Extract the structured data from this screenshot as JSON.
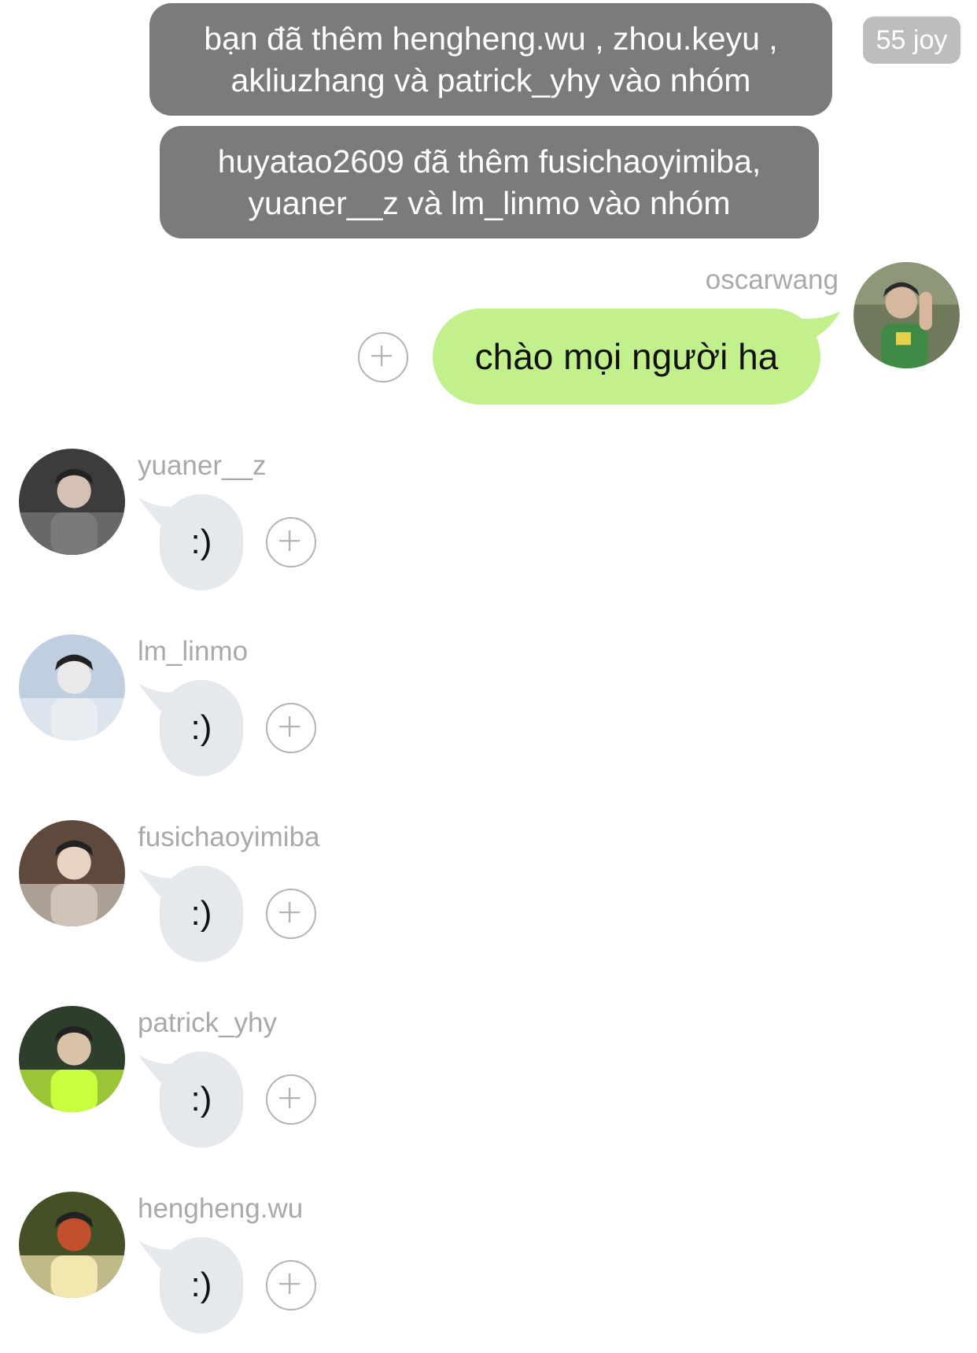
{
  "system_messages": [
    {
      "lines": [
        "bạn đã thêm hengheng.wu , zhou.keyu ,",
        "akliuzhang và patrick_yhy vào nhóm"
      ]
    },
    {
      "lines": [
        "huyatao2609 đã thêm fusichaoyimiba,",
        "yuaner__z và lm_linmo vào nhóm"
      ]
    }
  ],
  "badge": "55 joy",
  "outgoing": {
    "sender": "oscarwang",
    "text": "chào mọi người ha",
    "avatar_icon": "profile-photo"
  },
  "incoming": [
    {
      "sender": "yuaner__z",
      "text": ":)",
      "avatar_icon": "profile-photo"
    },
    {
      "sender": "lm_linmo",
      "text": ":)",
      "avatar_icon": "profile-photo"
    },
    {
      "sender": "fusichaoyimiba",
      "text": ":)",
      "avatar_icon": "profile-photo"
    },
    {
      "sender": "patrick_yhy",
      "text": ":)",
      "avatar_icon": "profile-photo"
    },
    {
      "sender": "hengheng.wu",
      "text": ":)",
      "avatar_icon": "profile-photo"
    }
  ],
  "colors": {
    "system_bubble": "#7b7b7b",
    "badge": "#bdbdbd",
    "outgoing_bubble": "#c1f08d",
    "incoming_bubble": "#e5e8ec",
    "username_text": "#a9a9a9"
  },
  "react_icon": "add-reaction-icon"
}
